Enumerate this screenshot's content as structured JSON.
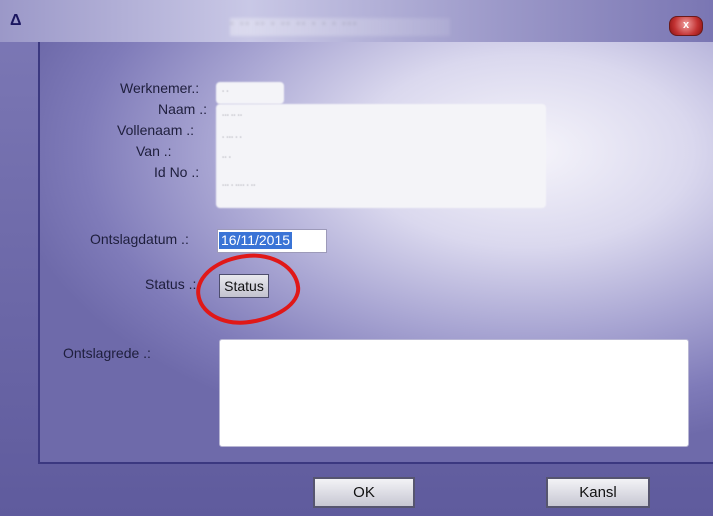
{
  "window": {
    "title_icon": "triangle-icon",
    "title_text": "· ·· ·· · ·· ·· · · · ···",
    "close_label": "x"
  },
  "form": {
    "werknemer_label": "Werknemer.:",
    "naam_label": "Naam .:",
    "vollenaam_label": "Vollenaam .:",
    "van_label": "Van .:",
    "idno_label": "Id No .:",
    "werknemer_value": "· ·",
    "naam_value": "··· ·· ··",
    "vollenaam_value": "· ··· · ·",
    "van_value": "·· ·",
    "idno_value": "··· · ···· · ··",
    "ontslagdatum_label": "Ontslagdatum .:",
    "ontslagdatum_value": "16/11/2015",
    "status_label": "Status .:",
    "status_button": "Status",
    "ontslagrede_label": "Ontslagrede .:",
    "ontslagrede_value": ""
  },
  "buttons": {
    "ok": "OK",
    "cancel": "Kansl"
  },
  "colors": {
    "annotation": "#e01818",
    "selection": "#3a74d6"
  }
}
